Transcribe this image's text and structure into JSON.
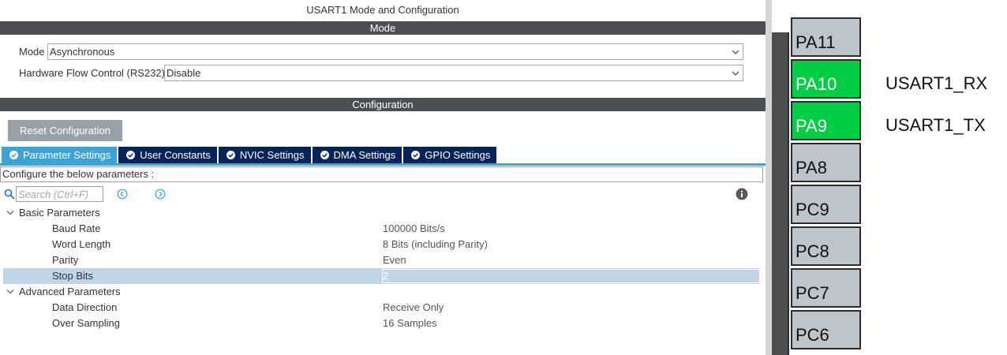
{
  "panel": {
    "title": "USART1 Mode and Configuration",
    "mode_section": "Mode",
    "mode_label": "Mode",
    "mode_value": "Asynchronous",
    "hfc_label": "Hardware Flow Control (RS232)",
    "hfc_value": "Disable",
    "config_section": "Configuration",
    "reset_label": "Reset Configuration",
    "tabs": [
      {
        "label": "Parameter Settings",
        "active": true
      },
      {
        "label": "User Constants",
        "active": false
      },
      {
        "label": "NVIC Settings",
        "active": false
      },
      {
        "label": "DMA Settings",
        "active": false
      },
      {
        "label": "GPIO Settings",
        "active": false
      }
    ],
    "configure_text": "Configure the below parameters :",
    "search_placeholder": "Search (Ctrl+F)",
    "groups": [
      {
        "label": "Basic Parameters",
        "params": [
          {
            "name": "Baud Rate",
            "value": "100000 Bits/s"
          },
          {
            "name": "Word Length",
            "value": "8 Bits (including Parity)"
          },
          {
            "name": "Parity",
            "value": "Even"
          },
          {
            "name": "Stop Bits",
            "value": "2",
            "selected": true
          }
        ]
      },
      {
        "label": "Advanced Parameters",
        "params": [
          {
            "name": "Data Direction",
            "value": "Receive Only"
          },
          {
            "name": "Over Sampling",
            "value": "16 Samples"
          }
        ]
      }
    ]
  },
  "chip": {
    "pins": [
      {
        "label": "PA11",
        "active": false
      },
      {
        "label": "PA10",
        "active": true
      },
      {
        "label": "PA9",
        "active": true
      },
      {
        "label": "PA8",
        "active": false
      },
      {
        "label": "PC9",
        "active": false
      },
      {
        "label": "PC8",
        "active": false
      },
      {
        "label": "PC7",
        "active": false
      },
      {
        "label": "PC6",
        "active": false
      }
    ],
    "signals": [
      {
        "label": "USART1_RX"
      },
      {
        "label": "USART1_TX"
      }
    ]
  },
  "colors": {
    "section_bar": "#4a4f55",
    "tab_active": "#3aa3d8",
    "tab_inactive": "#05255a",
    "pin_active": "#00cc44",
    "pin_inactive": "#bdc4ca",
    "selected_row": "#c2d4e8"
  }
}
